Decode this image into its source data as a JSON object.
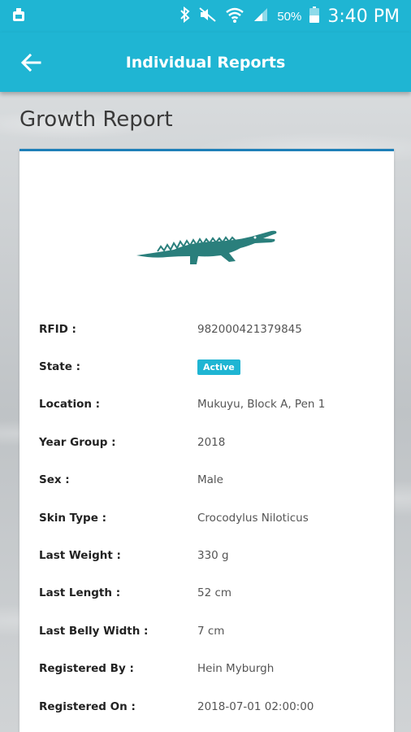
{
  "status_bar": {
    "battery": "50%",
    "time": "3:40 PM",
    "icons": [
      "notification-icon",
      "bluetooth-icon",
      "mute-icon",
      "wifi-icon",
      "signal-icon",
      "battery-icon"
    ]
  },
  "app_bar": {
    "title": "Individual Reports",
    "back_icon": "arrow-left-icon"
  },
  "page": {
    "title": "Growth Report"
  },
  "report": {
    "image": "crocodile-icon",
    "rows": [
      {
        "label": "RFID :",
        "value": "982000421379845"
      },
      {
        "label": "State :",
        "value": "Active"
      },
      {
        "label": "Location :",
        "value": "Mukuyu, Block A, Pen 1"
      },
      {
        "label": "Year Group :",
        "value": "2018"
      },
      {
        "label": "Sex :",
        "value": "Male"
      },
      {
        "label": "Skin Type :",
        "value": "Crocodylus Niloticus"
      },
      {
        "label": "Last Weight :",
        "value": "330 g"
      },
      {
        "label": "Last Length :",
        "value": "52 cm"
      },
      {
        "label": "Last Belly Width :",
        "value": "7 cm"
      },
      {
        "label": "Registered By :",
        "value": "Hein Myburgh"
      },
      {
        "label": "Registered On :",
        "value": "2018-07-01 02:00:00"
      }
    ]
  },
  "colors": {
    "accent": "#1fb5d3",
    "card_border": "#1e7fb8",
    "croc": "#2a7f7c"
  }
}
